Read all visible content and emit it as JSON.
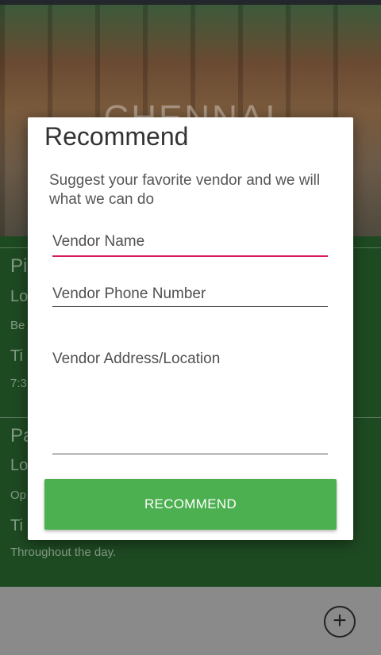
{
  "background": {
    "hero_city": "CHENNAI",
    "items": [
      {
        "title": "Pi",
        "label1": "Lo",
        "line1": "Be",
        "label2": "Ti",
        "line2": "7:3"
      },
      {
        "title": "Pa",
        "label1": "Lo",
        "line1": "Op",
        "label2": "Ti",
        "line2": "Throughout the day."
      }
    ],
    "fab_icon": "+"
  },
  "dialog": {
    "title": "Recommend",
    "message": "Suggest your favorite vendor and we will what we can do",
    "fields": {
      "vendor_name": "Vendor Name",
      "vendor_phone": "Vendor Phone Number",
      "vendor_address": "Vendor Address/Location"
    },
    "button_label": "RECOMMEND"
  },
  "colors": {
    "accent": "#d81b60",
    "button": "#4caf50",
    "list_bg": "#1e4a22"
  }
}
